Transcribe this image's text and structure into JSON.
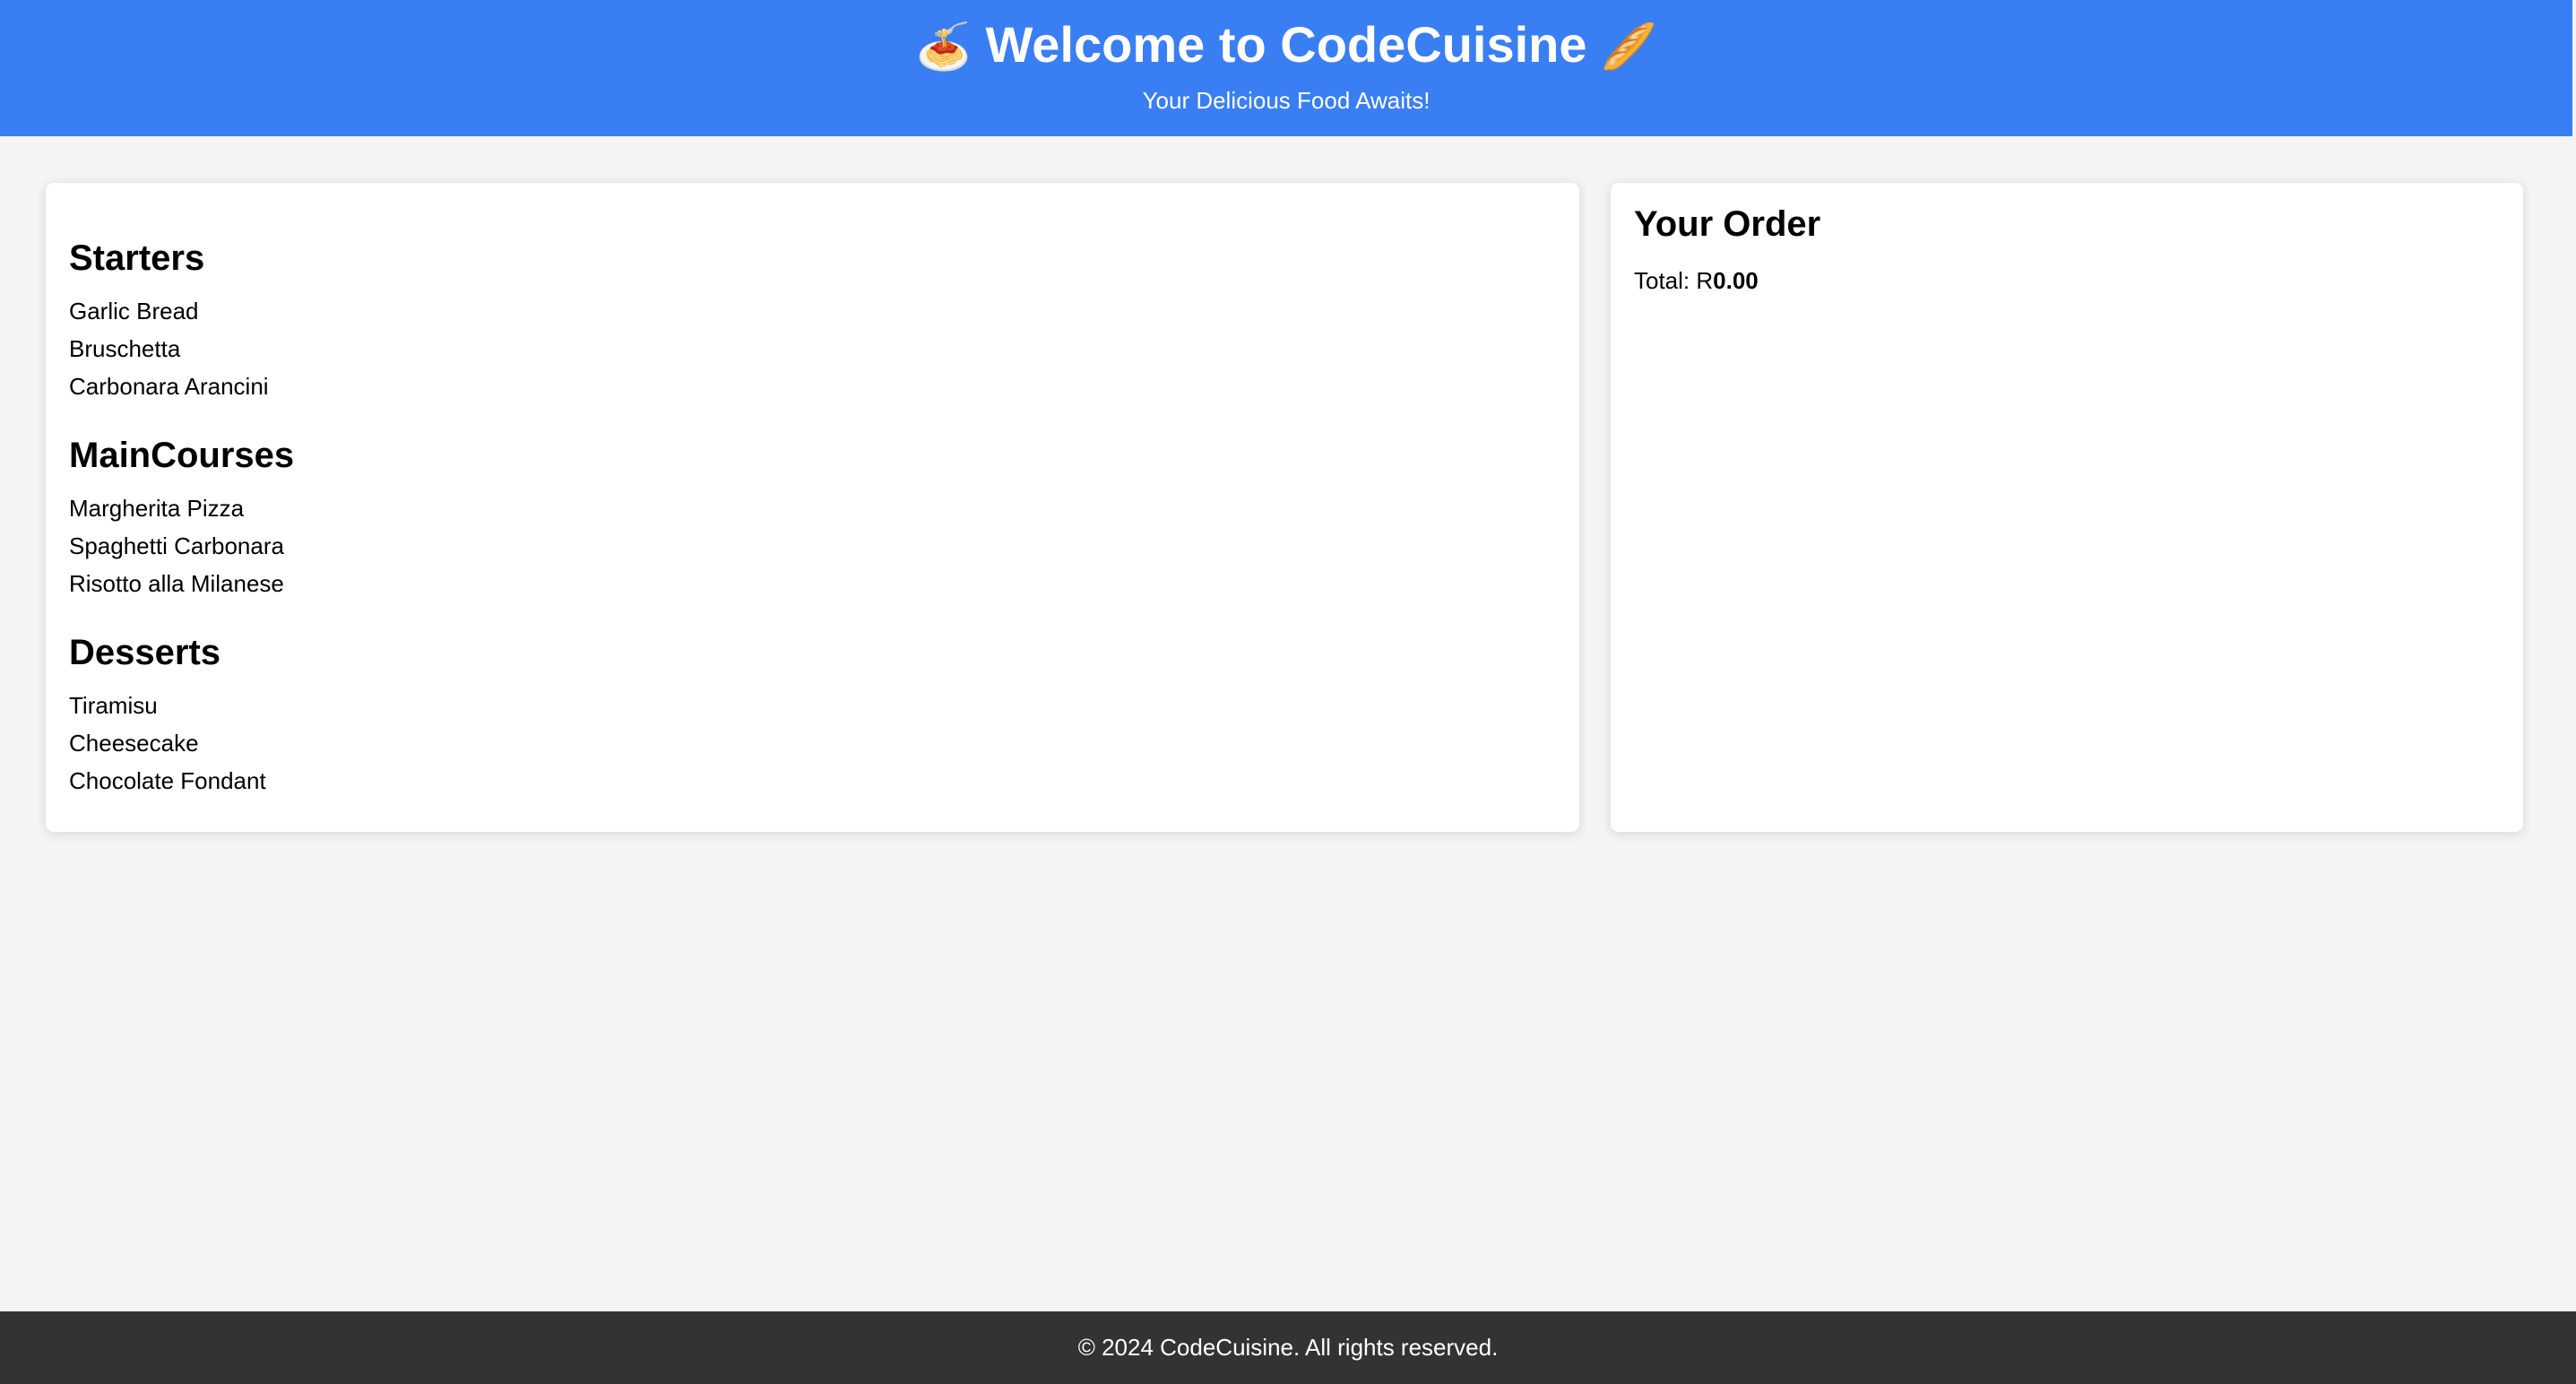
{
  "header": {
    "title_left_emoji": "🍝",
    "title": "Welcome to CodeCuisine",
    "title_right_emoji": "🥖",
    "subtitle": "Your Delicious Food Awaits!"
  },
  "menu": {
    "sections": [
      {
        "title": "Starters",
        "items": [
          "Garlic Bread",
          "Bruschetta",
          "Carbonara Arancini"
        ]
      },
      {
        "title": "MainCourses",
        "items": [
          "Margherita Pizza",
          "Spaghetti Carbonara",
          "Risotto alla Milanese"
        ]
      },
      {
        "title": "Desserts",
        "items": [
          "Tiramisu",
          "Cheesecake",
          "Chocolate Fondant"
        ]
      }
    ]
  },
  "order": {
    "title": "Your Order",
    "total_label": "Total: R",
    "total_value": "0.00"
  },
  "footer": {
    "text": "© 2024 CodeCuisine. All rights reserved."
  },
  "colors": {
    "header_bg": "#3a7ef3",
    "page_bg": "#f4f4f4",
    "panel_bg": "#ffffff",
    "footer_bg": "#333333"
  }
}
